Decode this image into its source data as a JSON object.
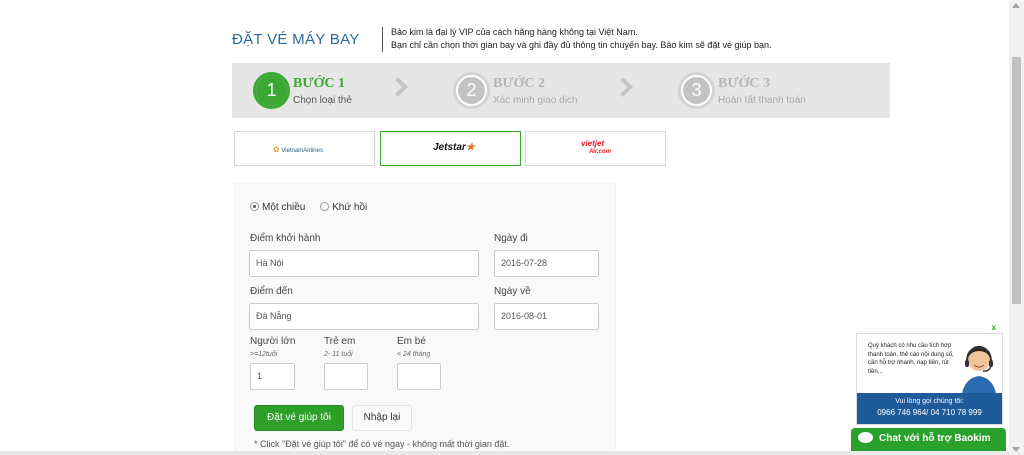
{
  "header": {
    "title": "ĐẶT VÉ MÁY BAY",
    "desc_line1": "Bảo kim là đại lý VIP của cách hãng hàng không tại Việt Nam.",
    "desc_line2": "Bạn chỉ cần chọn thời gian bay và ghi đầy đủ thông tin chuyến bay. Bảo kim sẽ đặt vé giúp bạn."
  },
  "steps": [
    {
      "num": "1",
      "title": "BƯỚC 1",
      "sub": "Chọn loại thẻ",
      "state": "active"
    },
    {
      "num": "2",
      "title": "BƯỚC 2",
      "sub": "Xác minh giao dịch",
      "state": "inactive"
    },
    {
      "num": "3",
      "title": "BƯỚC 3",
      "sub": "Hoàn tất thanh toán",
      "state": "inactive"
    }
  ],
  "airlines": {
    "vietnam": "VietnamAirlines",
    "jetstar": "Jetstar",
    "vietjet_top": "vietjet",
    "vietjet_bottom": "Air.com",
    "selected": "jetstar"
  },
  "form": {
    "trip_type": {
      "one_way": "Một chiều",
      "round_trip": "Khứ hồi",
      "selected": "one_way"
    },
    "origin": {
      "label": "Điểm khởi hành",
      "value": "Hà Nội"
    },
    "depart_date": {
      "label": "Ngày đi",
      "value": "2016-07-28"
    },
    "destination": {
      "label": "Điểm đến",
      "value": "Đà Nẵng"
    },
    "return_date": {
      "label": "Ngày về",
      "value": "2016-08-01"
    },
    "adults": {
      "label": "Người lớn",
      "hint": ">=12tuổi",
      "value": "1"
    },
    "children": {
      "label": "Trẻ em",
      "hint": "2- 11 tuổi",
      "value": ""
    },
    "infants": {
      "label": "Em bé",
      "hint": "< 24 tháng",
      "value": ""
    },
    "submit_label": "Đặt vé giúp tôi",
    "reset_label": "Nhập lại",
    "footnote": "* Click \"Đặt vé giúp tôi\" để có vé ngay - không mất thời gian đặt."
  },
  "support": {
    "close": "x",
    "message": "Quý khách có nhu cầu tích hợp thanh toán, thẻ cào nội dung số, cần hỗ trợ nhanh, nạp tiền, rút tiền,..",
    "call_label": "Vui lòng gọi chúng tôi:",
    "phones": "0966 746 964/  04 710 78 999",
    "chat_label": "Chat với hỗ trợ Baokim"
  },
  "colors": {
    "accent_green": "#3aa832",
    "title_blue": "#2a6b9e",
    "support_blue": "#1f5a9a"
  }
}
